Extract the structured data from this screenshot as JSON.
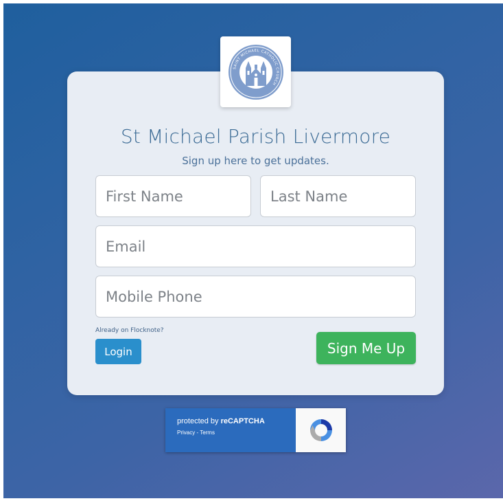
{
  "app": {
    "logo_text": "SAINT MICHAEL CATHOLIC CHURCH",
    "title": "St Michael Parish Livermore",
    "subtitle": "Sign up here to get updates."
  },
  "form": {
    "first_name_placeholder": "First Name",
    "last_name_placeholder": "Last Name",
    "email_placeholder": "Email",
    "phone_placeholder": "Mobile Phone",
    "already_text": "Already on Flocknote?",
    "login_label": "Login",
    "signup_label": "Sign Me Up"
  },
  "recaptcha": {
    "protected_prefix": "protected by ",
    "protected_brand": "reCAPTCHA",
    "links": "Privacy - Terms",
    "icon": "recaptcha-icon"
  },
  "colors": {
    "title": "#3a6a94",
    "signup_button": "#3db35c",
    "login_button": "#2a8fcc",
    "recaptcha_panel": "#2b6bbd"
  }
}
